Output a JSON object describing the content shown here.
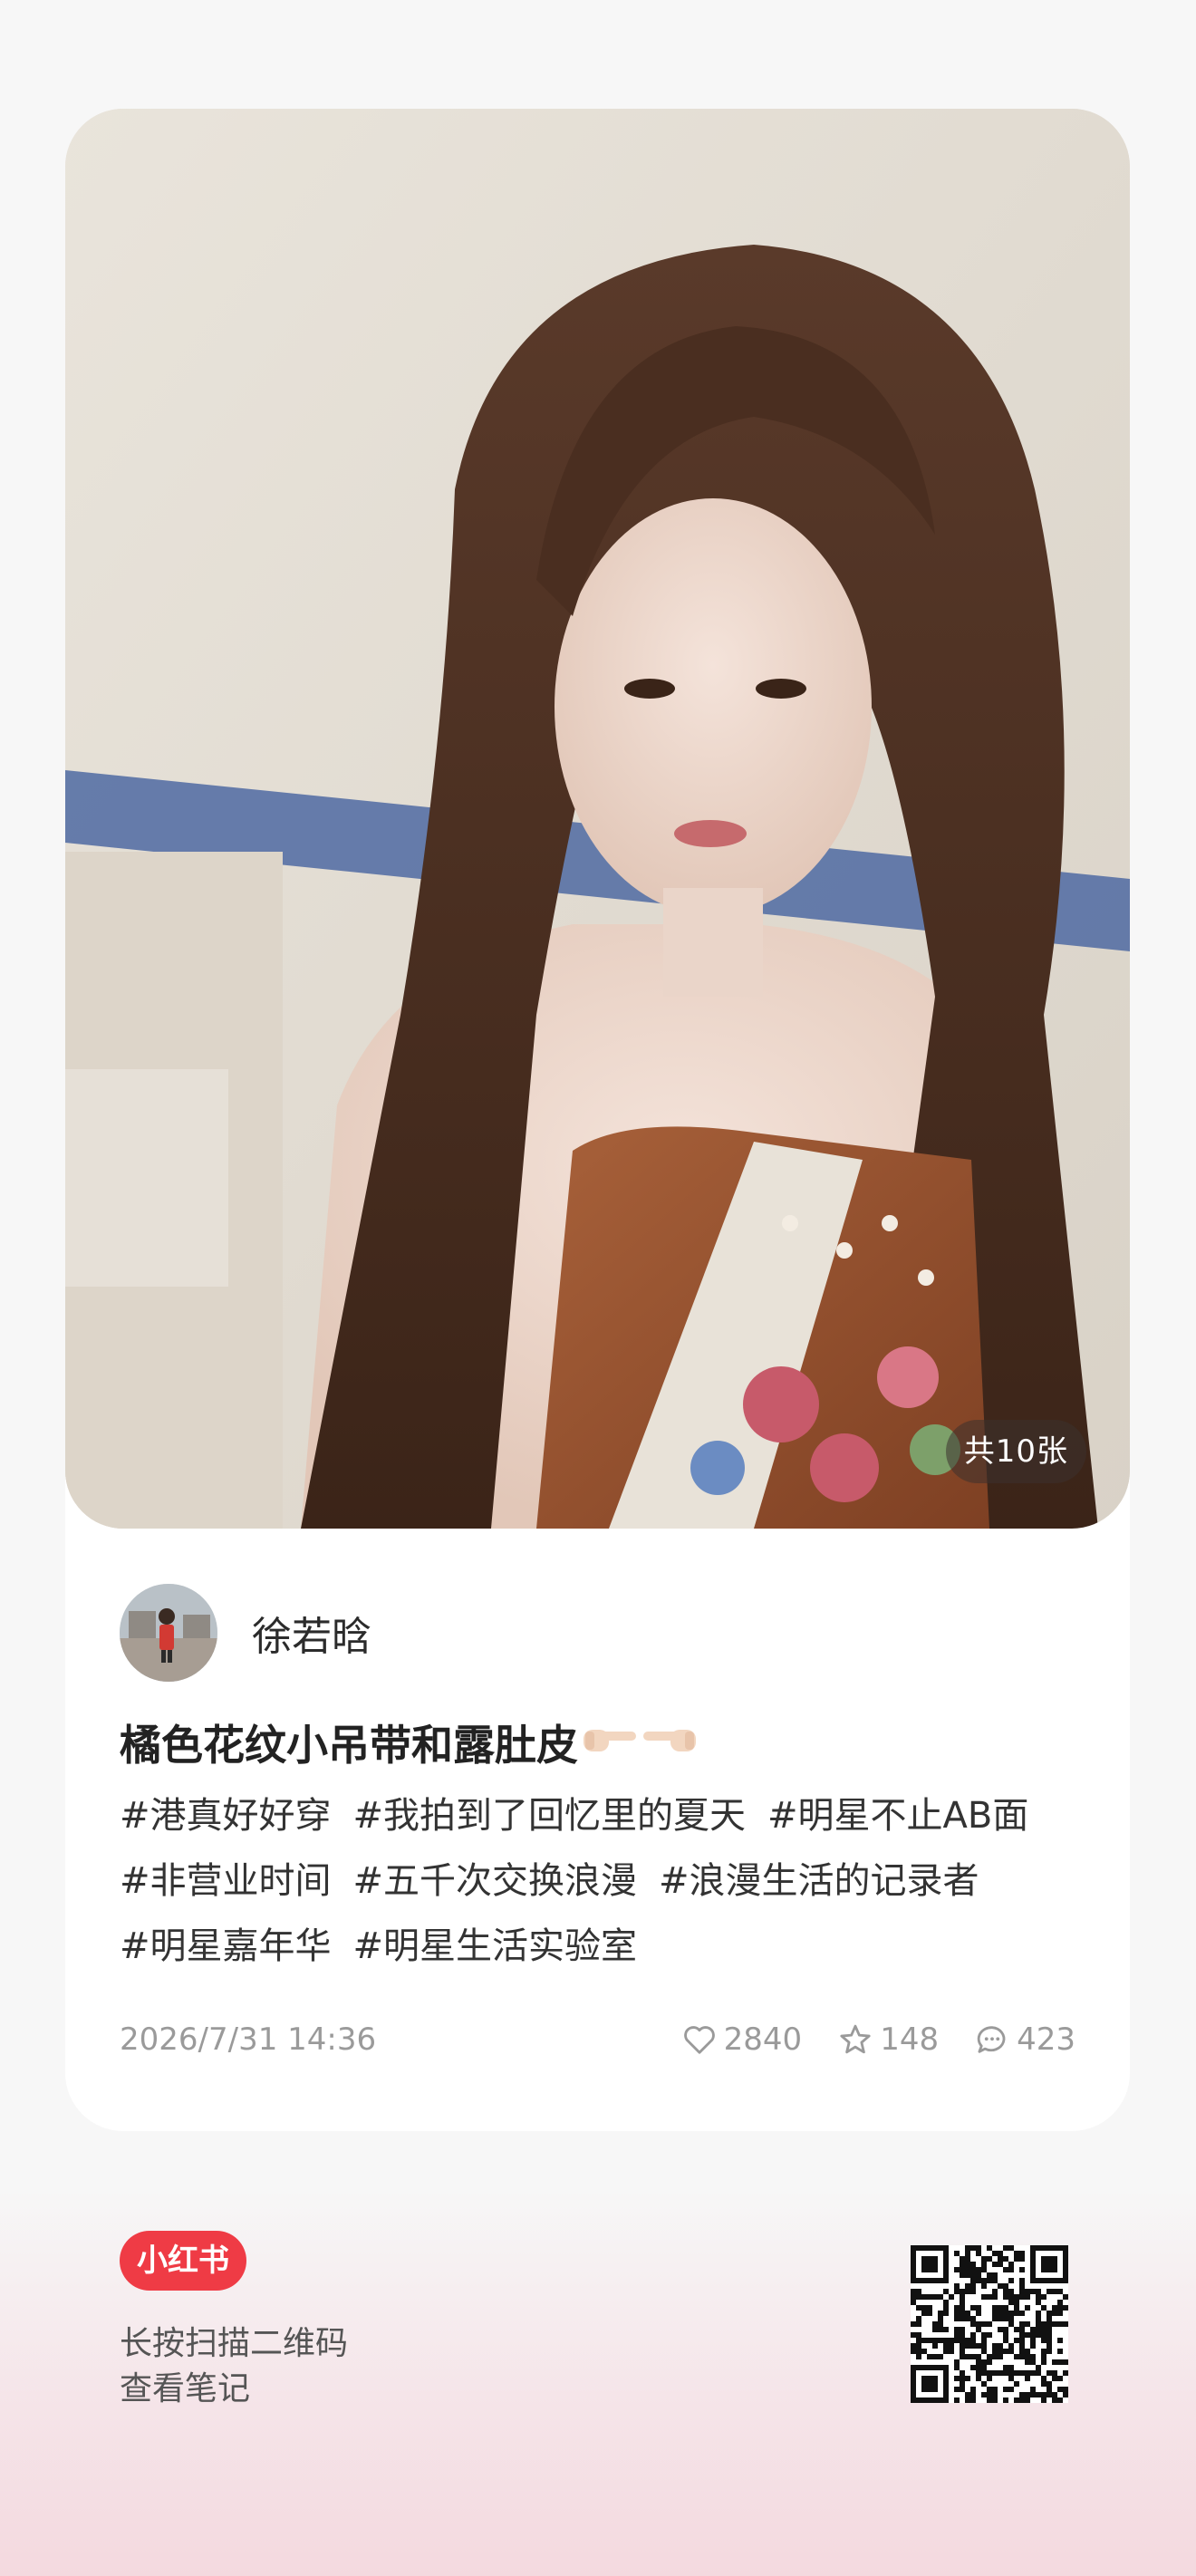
{
  "post": {
    "image_count_label": "共10张",
    "author_name": "徐若晗",
    "title": "橘色花纹小吊带和露肚皮",
    "title_emoji": [
      "finger-pointing-right-icon",
      "finger-pointing-left-icon"
    ],
    "tags": [
      "#港真好好穿",
      "#我拍到了回忆里的夏天",
      "#明星不止AB面",
      "#非营业时间",
      "#五千次交换浪漫",
      "#浪漫生活的记录者",
      "#明星嘉年华",
      "#明星生活实验室"
    ],
    "date": "2026/7/31 14:36",
    "likes": "2840",
    "favorites": "148",
    "comments": "423"
  },
  "footer": {
    "brand_label": "小红书",
    "hint_line1": "长按扫描二维码",
    "hint_line2": "查看笔记"
  },
  "colors": {
    "brand_red": "#ef3b45",
    "meta_gray": "#9a9a9a",
    "card_bg": "#ffffff",
    "page_bg": "#f7f7f7",
    "bottom_tint": "#f4d9df"
  }
}
